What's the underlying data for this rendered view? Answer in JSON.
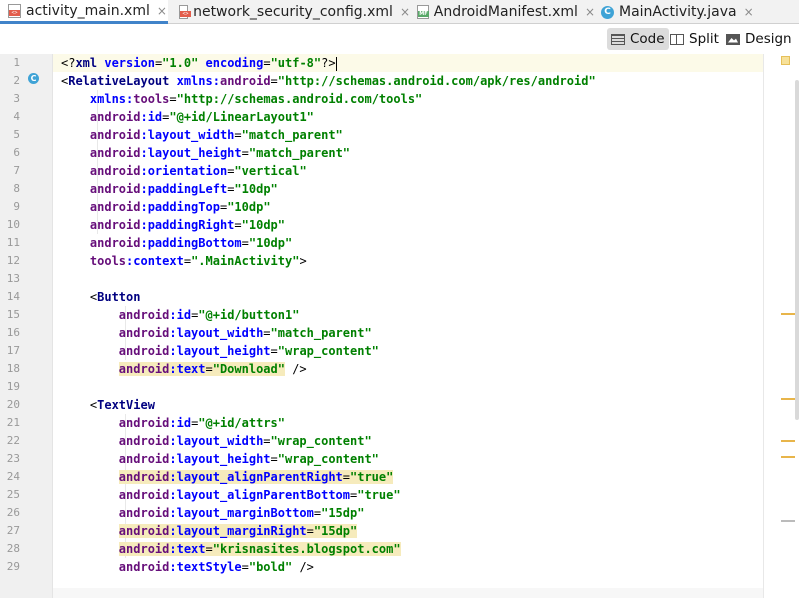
{
  "tabs": [
    {
      "label": "activity_main.xml",
      "icon": "xml-file-icon",
      "active": true
    },
    {
      "label": "network_security_config.xml",
      "icon": "xml-file-icon",
      "active": false
    },
    {
      "label": "AndroidManifest.xml",
      "icon": "manifest-file-icon",
      "active": false
    },
    {
      "label": "MainActivity.java",
      "icon": "java-class-icon",
      "active": false
    }
  ],
  "tab_close_glyph": "×",
  "class_icon_letter": "C",
  "view_modes": {
    "code": "Code",
    "split": "Split",
    "design": "Design",
    "selected": "Code"
  },
  "line_numbers": [
    "1",
    "2",
    "3",
    "4",
    "5",
    "6",
    "7",
    "8",
    "9",
    "10",
    "11",
    "12",
    "13",
    "14",
    "15",
    "16",
    "17",
    "18",
    "19",
    "20",
    "21",
    "22",
    "23",
    "24",
    "25",
    "26",
    "27",
    "28",
    "29"
  ],
  "code_lines": [
    [
      [
        "pi",
        "<?"
      ],
      [
        "tag",
        "xml "
      ],
      [
        "attr",
        "version"
      ],
      [
        "pun",
        "="
      ],
      [
        "val",
        "\"1.0\""
      ],
      [
        "pun",
        " "
      ],
      [
        "attr",
        "encoding"
      ],
      [
        "pun",
        "="
      ],
      [
        "val",
        "\"utf-8\""
      ],
      [
        "pi",
        "?>"
      ]
    ],
    [
      [
        "pun",
        "<"
      ],
      [
        "tag",
        "RelativeLayout "
      ],
      [
        "attr",
        "xmlns:"
      ],
      [
        "ns",
        "android"
      ],
      [
        "pun",
        "="
      ],
      [
        "val",
        "\"http://schemas.android.com/apk/res/android\""
      ]
    ],
    [
      [
        "pun",
        "    "
      ],
      [
        "attr",
        "xmlns:"
      ],
      [
        "ns",
        "tools"
      ],
      [
        "pun",
        "="
      ],
      [
        "val",
        "\"http://schemas.android.com/tools\""
      ]
    ],
    [
      [
        "pun",
        "    "
      ],
      [
        "ns",
        "android"
      ],
      [
        "attr",
        ":id"
      ],
      [
        "pun",
        "="
      ],
      [
        "val",
        "\"@+id/LinearLayout1\""
      ]
    ],
    [
      [
        "pun",
        "    "
      ],
      [
        "ns",
        "android"
      ],
      [
        "attr",
        ":layout_width"
      ],
      [
        "pun",
        "="
      ],
      [
        "val",
        "\"match_parent\""
      ]
    ],
    [
      [
        "pun",
        "    "
      ],
      [
        "ns",
        "android"
      ],
      [
        "attr",
        ":layout_height"
      ],
      [
        "pun",
        "="
      ],
      [
        "val",
        "\"match_parent\""
      ]
    ],
    [
      [
        "pun",
        "    "
      ],
      [
        "ns",
        "android"
      ],
      [
        "attr",
        ":orientation"
      ],
      [
        "pun",
        "="
      ],
      [
        "val",
        "\"vertical\""
      ]
    ],
    [
      [
        "pun",
        "    "
      ],
      [
        "ns",
        "android"
      ],
      [
        "attr",
        ":paddingLeft"
      ],
      [
        "pun",
        "="
      ],
      [
        "val",
        "\"10dp\""
      ]
    ],
    [
      [
        "pun",
        "    "
      ],
      [
        "ns",
        "android"
      ],
      [
        "attr",
        ":paddingTop"
      ],
      [
        "pun",
        "="
      ],
      [
        "val",
        "\"10dp\""
      ]
    ],
    [
      [
        "pun",
        "    "
      ],
      [
        "ns",
        "android"
      ],
      [
        "attr",
        ":paddingRight"
      ],
      [
        "pun",
        "="
      ],
      [
        "val",
        "\"10dp\""
      ]
    ],
    [
      [
        "pun",
        "    "
      ],
      [
        "ns",
        "android"
      ],
      [
        "attr",
        ":paddingBottom"
      ],
      [
        "pun",
        "="
      ],
      [
        "val",
        "\"10dp\""
      ]
    ],
    [
      [
        "pun",
        "    "
      ],
      [
        "ns",
        "tools"
      ],
      [
        "attr",
        ":context"
      ],
      [
        "pun",
        "="
      ],
      [
        "val",
        "\".MainActivity\""
      ],
      [
        "pun",
        ">"
      ]
    ],
    [],
    [
      [
        "pun",
        "    <"
      ],
      [
        "tag",
        "Button"
      ]
    ],
    [
      [
        "pun",
        "        "
      ],
      [
        "ns",
        "android"
      ],
      [
        "attr",
        ":id"
      ],
      [
        "pun",
        "="
      ],
      [
        "val",
        "\"@+id/button1\""
      ]
    ],
    [
      [
        "pun",
        "        "
      ],
      [
        "ns",
        "android"
      ],
      [
        "attr",
        ":layout_width"
      ],
      [
        "pun",
        "="
      ],
      [
        "val",
        "\"match_parent\""
      ]
    ],
    [
      [
        "pun",
        "        "
      ],
      [
        "ns",
        "android"
      ],
      [
        "attr",
        ":layout_height"
      ],
      [
        "pun",
        "="
      ],
      [
        "val",
        "\"wrap_content\""
      ]
    ],
    [
      [
        "pun",
        "        "
      ],
      [
        "hl-ns",
        "android"
      ],
      [
        "hl-attr",
        ":text"
      ],
      [
        "hl-pun",
        "="
      ],
      [
        "hl-val",
        "\"Download\""
      ],
      [
        "pun",
        " />"
      ]
    ],
    [],
    [
      [
        "pun",
        "    <"
      ],
      [
        "tag",
        "TextView"
      ]
    ],
    [
      [
        "pun",
        "        "
      ],
      [
        "ns",
        "android"
      ],
      [
        "attr",
        ":id"
      ],
      [
        "pun",
        "="
      ],
      [
        "val",
        "\"@+id/attrs\""
      ]
    ],
    [
      [
        "pun",
        "        "
      ],
      [
        "ns",
        "android"
      ],
      [
        "attr",
        ":layout_width"
      ],
      [
        "pun",
        "="
      ],
      [
        "val",
        "\"wrap_content\""
      ]
    ],
    [
      [
        "pun",
        "        "
      ],
      [
        "ns",
        "android"
      ],
      [
        "attr",
        ":layout_height"
      ],
      [
        "pun",
        "="
      ],
      [
        "val",
        "\"wrap_content\""
      ]
    ],
    [
      [
        "pun",
        "        "
      ],
      [
        "hl-ns",
        "android"
      ],
      [
        "hl-attr",
        ":layout_alignParentRight"
      ],
      [
        "hl-pun",
        "="
      ],
      [
        "hl-val",
        "\"true\""
      ]
    ],
    [
      [
        "pun",
        "        "
      ],
      [
        "ns",
        "android"
      ],
      [
        "attr",
        ":layout_alignParentBottom"
      ],
      [
        "pun",
        "="
      ],
      [
        "val",
        "\"true\""
      ]
    ],
    [
      [
        "pun",
        "        "
      ],
      [
        "ns",
        "android"
      ],
      [
        "attr",
        ":layout_marginBottom"
      ],
      [
        "pun",
        "="
      ],
      [
        "val",
        "\"15dp\""
      ]
    ],
    [
      [
        "pun",
        "        "
      ],
      [
        "hl-ns",
        "android"
      ],
      [
        "hl-attr",
        ":layout_marginRight"
      ],
      [
        "hl-pun",
        "="
      ],
      [
        "hl-val",
        "\"15dp\""
      ]
    ],
    [
      [
        "pun",
        "        "
      ],
      [
        "hl-ns",
        "android"
      ],
      [
        "hl-attr",
        ":text"
      ],
      [
        "hl-pun",
        "="
      ],
      [
        "hl-val",
        "\"krisnasites.blogspot.com\""
      ]
    ],
    [
      [
        "pun",
        "        "
      ],
      [
        "ns",
        "android"
      ],
      [
        "attr",
        ":textStyle"
      ],
      [
        "pun",
        "="
      ],
      [
        "val",
        "\"bold\""
      ],
      [
        "pun",
        " />"
      ]
    ]
  ],
  "colors": {
    "accent": "#4083c9",
    "tag": "#000080",
    "attribute": "#0000ff",
    "namespace": "#660e7a",
    "value": "#008000",
    "warning_highlight": "#f6ebbc",
    "warning_mark": "#e8b54a"
  }
}
